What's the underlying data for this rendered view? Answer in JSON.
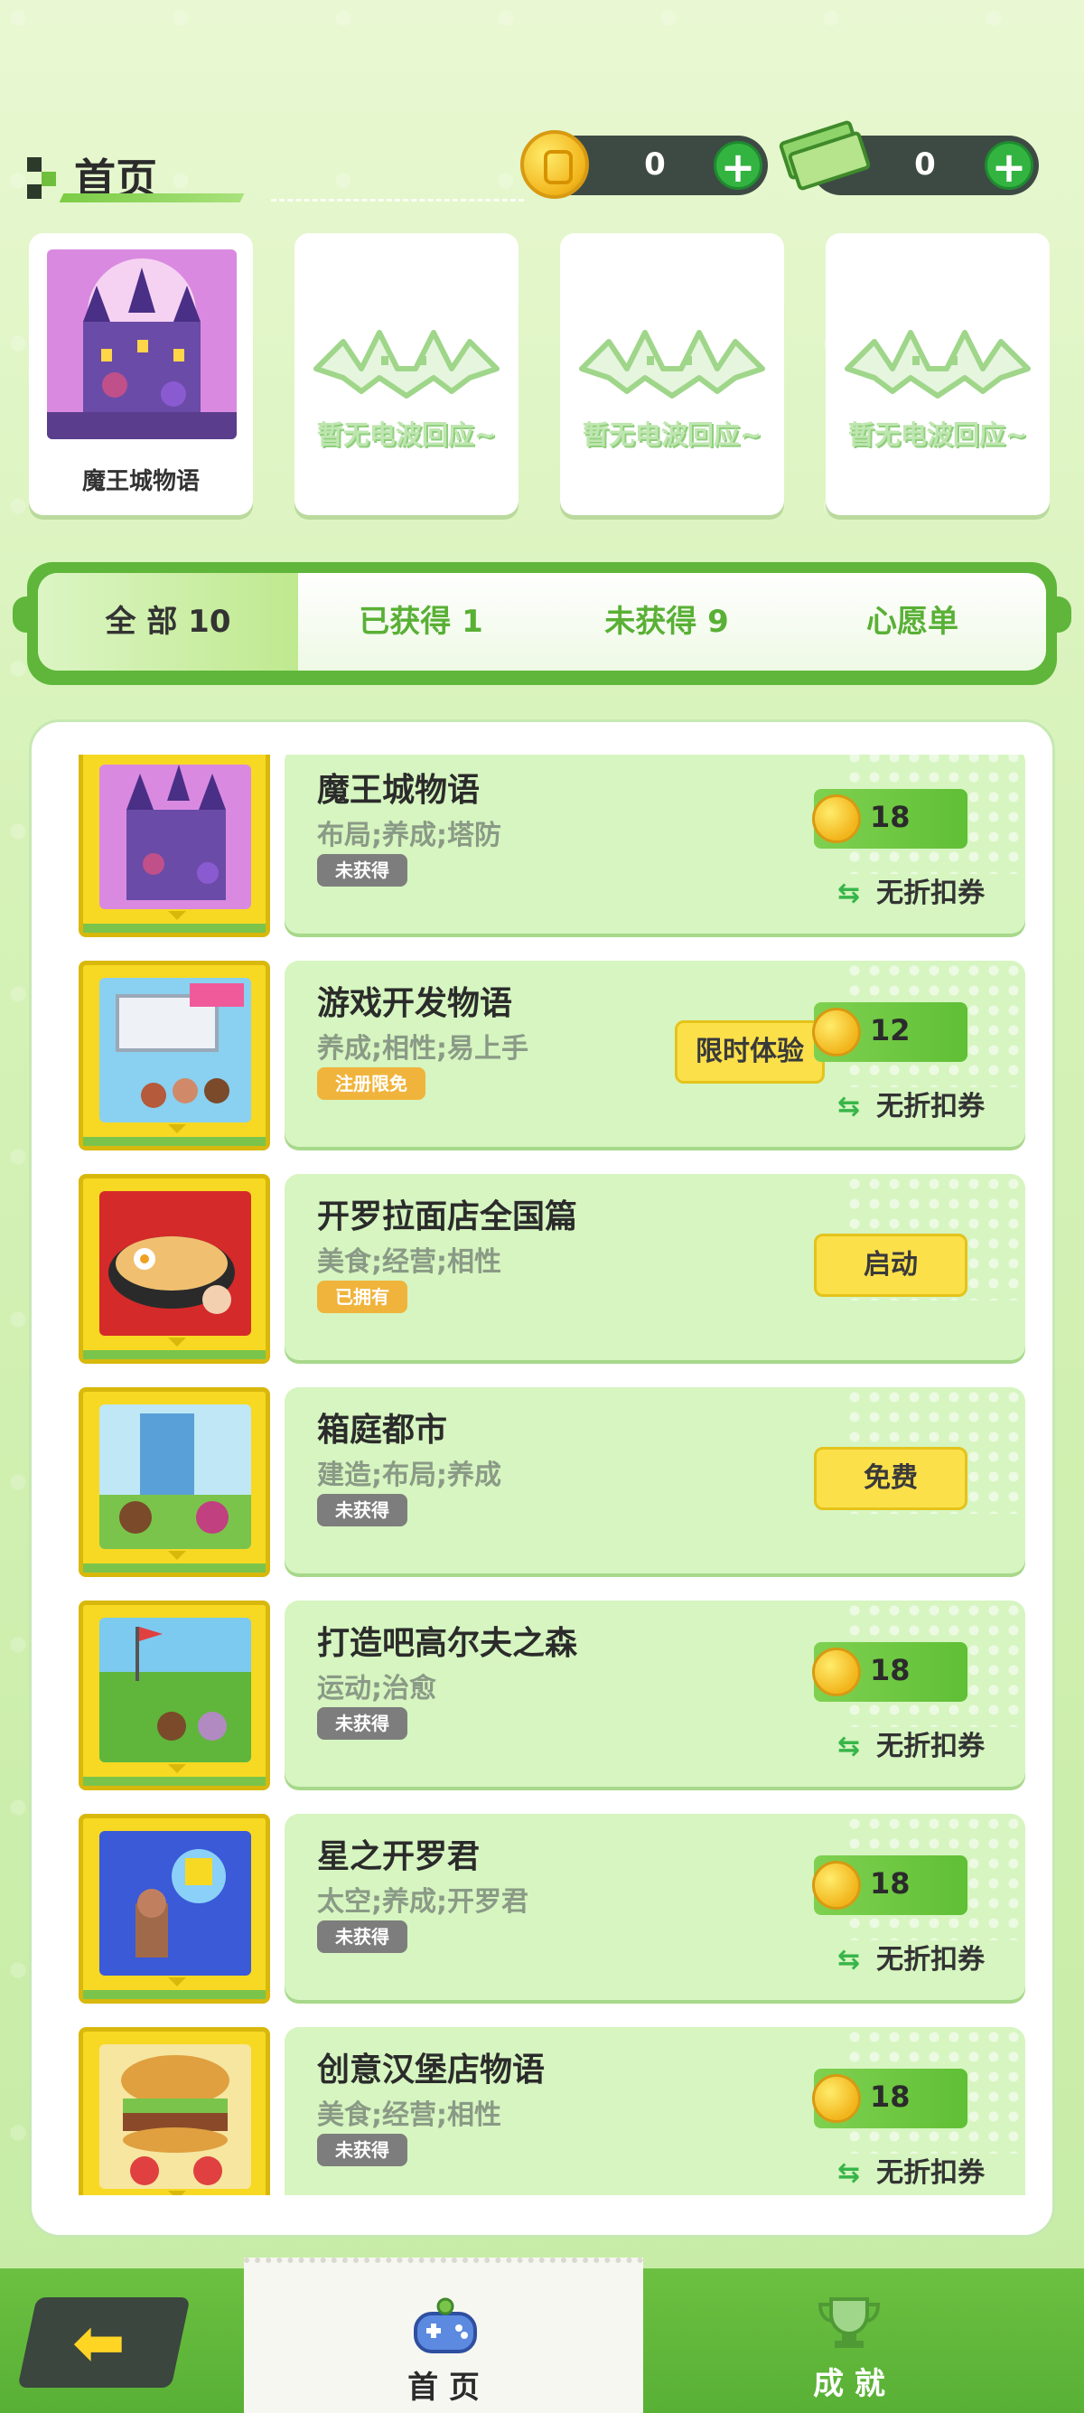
{
  "header": {
    "title": "首页",
    "coins": "0",
    "cash": "0"
  },
  "recent": {
    "first_caption": "魔王城物语",
    "empty_text": "暂无电波回应~"
  },
  "tabs": [
    {
      "label": "全 部 10"
    },
    {
      "label": "已获得 1"
    },
    {
      "label": "未获得 9"
    },
    {
      "label": "心愿单"
    }
  ],
  "list": [
    {
      "name": "魔王城物语",
      "tags": "布局;养成;塔防",
      "badge": "未获得",
      "price": "18",
      "discount": "无折扣券"
    },
    {
      "name": "游戏开发物语",
      "tags": "养成;相性;易上手",
      "badge": "注册限免",
      "trial": "限时体验",
      "price": "12",
      "discount": "无折扣券"
    },
    {
      "name": "开罗拉面店全国篇",
      "tags": "美食;经营;相性",
      "badge": "已拥有",
      "action": "启动"
    },
    {
      "name": "箱庭都市",
      "tags": "建造;布局;养成",
      "badge": "未获得",
      "action": "免费"
    },
    {
      "name": "打造吧高尔夫之森",
      "tags": "运动;治愈",
      "badge": "未获得",
      "price": "18",
      "discount": "无折扣券"
    },
    {
      "name": "星之开罗君",
      "tags": "太空;养成;开罗君",
      "badge": "未获得",
      "price": "18",
      "discount": "无折扣券"
    },
    {
      "name": "创意汉堡店物语",
      "tags": "美食;经营;相性",
      "badge": "未获得",
      "price": "18",
      "discount": "无折扣券"
    }
  ],
  "bottom_nav": {
    "home": "首 页",
    "achievements": "成 就"
  },
  "colors": {
    "accent": "#5fb63a",
    "card": "#d6f5c0",
    "cartridge": "#f7d923"
  }
}
